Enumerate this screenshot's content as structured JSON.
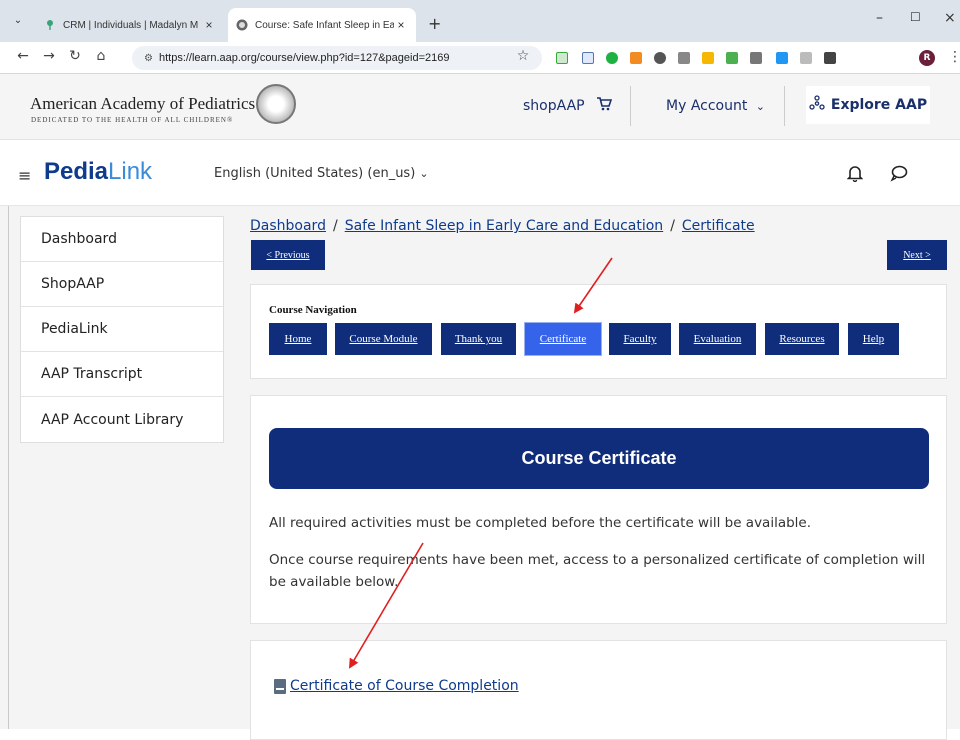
{
  "browser": {
    "tabs": [
      {
        "title": "CRM | Individuals | Madalyn M"
      },
      {
        "title": "Course: Safe Infant Sleep in Earl"
      }
    ],
    "url": "https://learn.aap.org/course/view.php?id=127&pageid=2169",
    "profile_initial": "R",
    "colors": {
      "chrome": "#dde3ea",
      "omnibox": "#eef1f5"
    }
  },
  "aap_header": {
    "logo_text": "American Academy of Pediatrics",
    "tagline": "DEDICATED TO THE HEALTH OF ALL CHILDREN®",
    "shop_label": "shopAAP",
    "account_label": "My Account",
    "explore_label": "Explore AAP"
  },
  "pedialink_bar": {
    "logo_bold": "Pedia",
    "logo_light": "Link",
    "language": "English (United States) (en_us)"
  },
  "sidebar": {
    "items": [
      {
        "label": "Dashboard"
      },
      {
        "label": "ShopAAP"
      },
      {
        "label": "PediaLink"
      },
      {
        "label": "AAP Transcript"
      },
      {
        "label": "AAP Account Library"
      }
    ]
  },
  "breadcrumb": {
    "items": [
      {
        "label": "Dashboard"
      },
      {
        "label": "Safe Infant Sleep in Early Care and Education"
      },
      {
        "label": "Certificate"
      }
    ],
    "separator": "/"
  },
  "pager": {
    "previous_label": "< Previous",
    "next_label": "Next >"
  },
  "course_navigation": {
    "title": "Course Navigation",
    "buttons": [
      {
        "label": "Home"
      },
      {
        "label": "Course Module"
      },
      {
        "label": "Thank you"
      },
      {
        "label": "Certificate",
        "active": true
      },
      {
        "label": "Faculty"
      },
      {
        "label": "Evaluation"
      },
      {
        "label": "Resources"
      },
      {
        "label": "Help"
      }
    ]
  },
  "certificate_section": {
    "heading": "Course Certificate",
    "paragraph_1": "All required activities must be completed before the certificate will be available.",
    "paragraph_2": "Once course requirements have been met, access to a personalized certificate of completion will be available below.",
    "link_label": "Certificate of Course Completion"
  },
  "colors": {
    "navy": "#0f2d7a",
    "active_button": "#3564ea",
    "link": "#0f3b8c",
    "annotation_arrow": "#e02020"
  }
}
